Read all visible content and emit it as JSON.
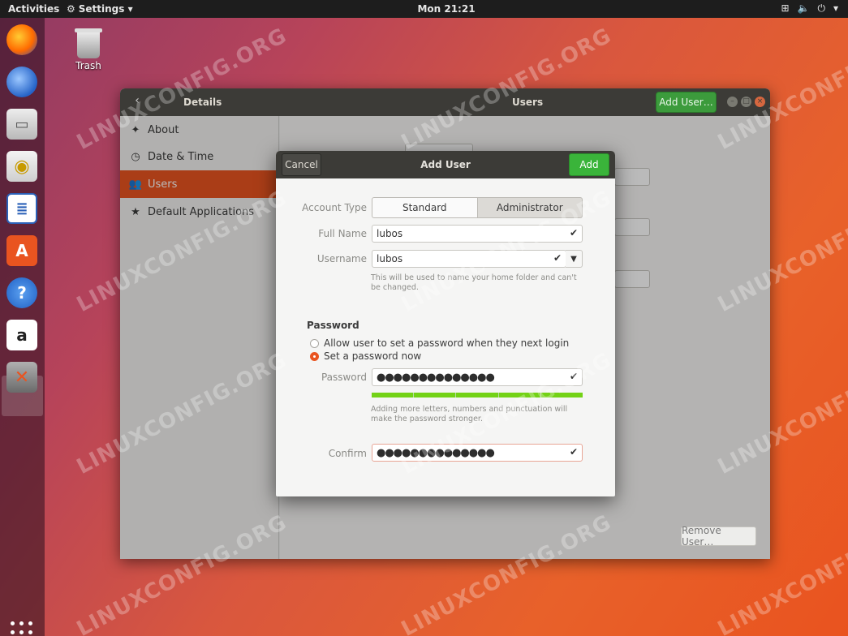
{
  "topbar": {
    "activities": "Activities",
    "app_menu": "Settings",
    "clock": "Mon 21:21"
  },
  "dock": {
    "items": [
      "firefox-icon",
      "thunderbird-icon",
      "files-icon",
      "rhythmbox-icon",
      "writer-icon",
      "software-center-icon",
      "help-icon",
      "amazon-icon",
      "settings-icon"
    ]
  },
  "desktop": {
    "trash_label": "Trash"
  },
  "window": {
    "sidebar_title": "Details",
    "title": "Users",
    "add_user_button": "Add User…",
    "sidebar": [
      {
        "label": "About",
        "icon": "star-icon"
      },
      {
        "label": "Date & Time",
        "icon": "clock-icon"
      },
      {
        "label": "Users",
        "icon": "people-icon"
      },
      {
        "label": "Default Applications",
        "icon": "star-icon"
      }
    ],
    "remove_user_button": "Remove User…"
  },
  "dialog": {
    "cancel": "Cancel",
    "title": "Add User",
    "add": "Add",
    "account_type_label": "Account Type",
    "account_type_standard": "Standard",
    "account_type_admin": "Administrator",
    "full_name_label": "Full Name",
    "full_name_value": "lubos",
    "username_label": "Username",
    "username_value": "lubos",
    "username_hint": "This will be used to name your home folder and can't be changed.",
    "password_section": "Password",
    "radio_next_login": "Allow user to set a password when they next login",
    "radio_set_now": "Set a password now",
    "password_label": "Password",
    "password_value": "●●●●●●●●●●●●●●",
    "password_hint": "Adding more letters, numbers and punctuation will make the password stronger.",
    "confirm_label": "Confirm",
    "confirm_value": "●●●●●●●●●●●●●●",
    "strength_fraction": 1.0
  },
  "watermark": "LINUXCONFIG.ORG",
  "colors": {
    "accent": "#e95420",
    "add_green": "#3ab43a",
    "meter_green": "#73d216"
  }
}
